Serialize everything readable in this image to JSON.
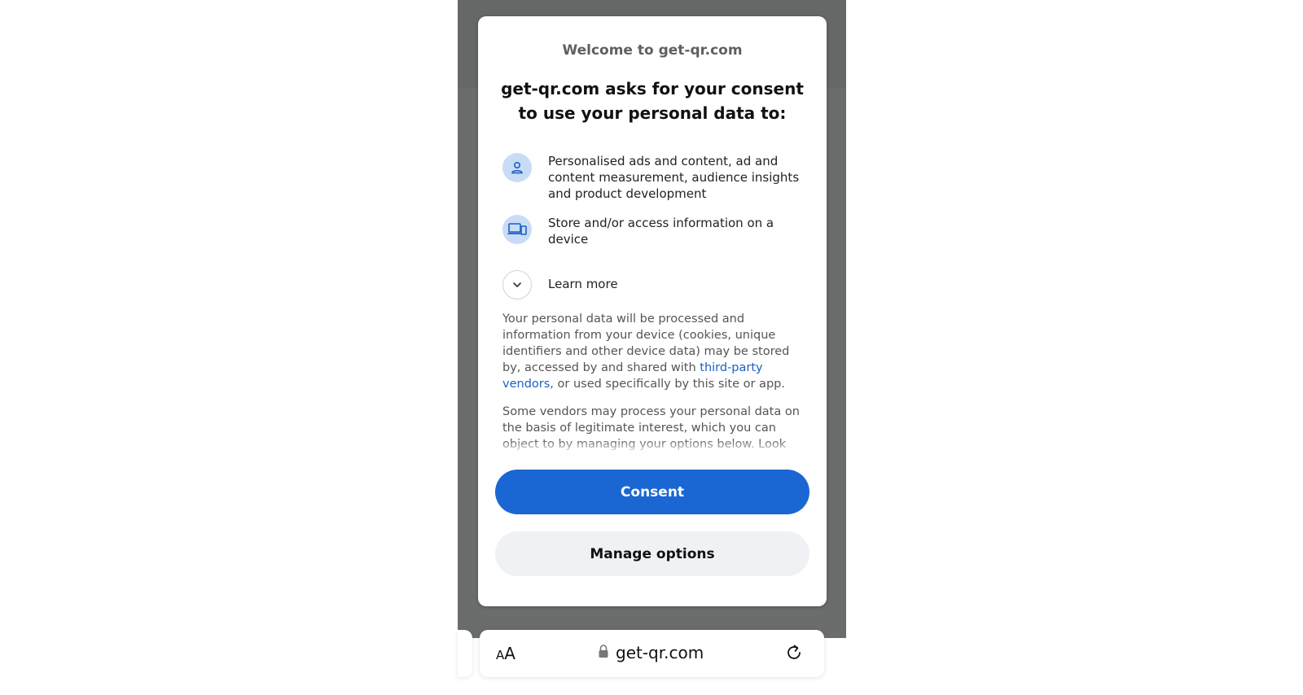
{
  "dialog": {
    "welcome": "Welcome to get-qr.com",
    "headline": "get-qr.com asks for your consent to use your personal data to:",
    "purposes": [
      {
        "icon": "person-icon",
        "text": "Personalised ads and content, ad and content measurement, audience insights and product development"
      },
      {
        "icon": "devices-icon",
        "text": "Store and/or access information on a device"
      }
    ],
    "learn_more": "Learn more",
    "paragraph1_a": "Your personal data will be processed and information from your device (cookies, unique identifiers and other device data) may be stored by, accessed by and shared with ",
    "paragraph1_link": "third-party vendors",
    "paragraph1_b": ", or used specifically by this site or app.",
    "paragraph2": "Some vendors may process your personal data on the basis of legitimate interest, which you can object to by managing your options below. Look for a link at the bottom of this page or in our privacy",
    "consent_label": "Consent",
    "manage_label": "Manage options"
  },
  "browser": {
    "text_size_large": "A",
    "text_size_small": "A",
    "url": "get-qr.com"
  },
  "colors": {
    "accent": "#1a66d3",
    "link": "#1a5fc4",
    "backdrop": "#6b6c6c"
  }
}
